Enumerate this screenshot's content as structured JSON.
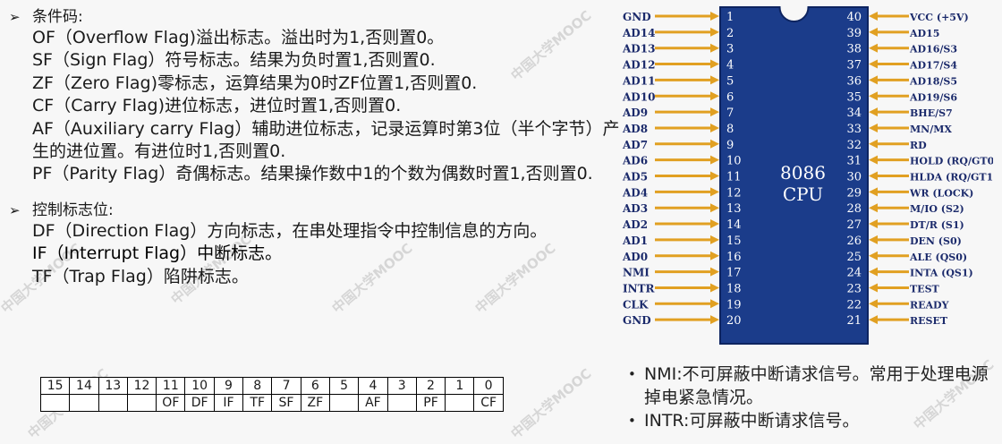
{
  "watermark": "中国大学MOOC",
  "condition": {
    "title": "条件码:",
    "lines": [
      "OF（Overflow Flag)溢出标志。溢出时为1,否则置0。",
      "SF（Sign Flag）符号标志。结果为负时置1,否则置0.",
      "ZF（Zero Flag)零标志，运算结果为0时ZF位置1,否则置0.",
      "CF（Carry Flag)进位标志，进位时置1,否则置0.",
      "AF（Auxiliary carry Flag）辅助进位标志，记录运算时第3位（半个字节）产生的进位置。有进位时1,否则置0.",
      "PF（Parity Flag）奇偶标志。结果操作数中1的个数为偶数时置1,否则置0."
    ]
  },
  "control": {
    "title": "控制标志位:",
    "lines": [
      "DF（Direction Flag）方向标志，在串处理指令中控制信息的方向。",
      "IF（Interrupt Flag）中断标志。",
      "TF（Trap Flag）陷阱标志。"
    ]
  },
  "flag_table": {
    "bits": [
      "15",
      "14",
      "13",
      "12",
      "11",
      "10",
      "9",
      "8",
      "7",
      "6",
      "5",
      "4",
      "3",
      "2",
      "1",
      "0"
    ],
    "names": [
      "",
      "",
      "",
      "",
      "OF",
      "DF",
      "IF",
      "TF",
      "SF",
      "ZF",
      "",
      "AF",
      "",
      "PF",
      "",
      "CF"
    ]
  },
  "chip": {
    "name": "8086",
    "sub": "CPU",
    "left_pins": [
      "GND",
      "AD14",
      "AD13",
      "AD12",
      "AD11",
      "AD10",
      "AD9",
      "AD8",
      "AD7",
      "AD6",
      "AD5",
      "AD4",
      "AD3",
      "AD2",
      "AD1",
      "AD0",
      "NMI",
      "INTR",
      "CLK",
      "GND"
    ],
    "right_pins": [
      "VCC (+5V)",
      "AD15",
      "AD16/S3",
      "AD17/S4",
      "AD18/S5",
      "AD19/S6",
      "BHE/S7",
      "MN/MX",
      "RD",
      "HOLD (RQ/GT0)",
      "HLDA (RQ/GT1)",
      "WR (LOCK)",
      "M/IO (S2)",
      "DT/R (S1)",
      "DEN (S0)",
      "ALE (QS0)",
      "INTA (QS1)",
      "TEST",
      "READY",
      "RESET"
    ]
  },
  "bullets": [
    "NMI:不可屏蔽中断请求信号。常用于处理电源掉电紧急情况。",
    "INTR:可屏蔽中断请求信号。"
  ],
  "colors": {
    "chip_fill": "#1b3c8a",
    "chip_border": "#0d2460",
    "pin_gold": "#e1a022"
  }
}
